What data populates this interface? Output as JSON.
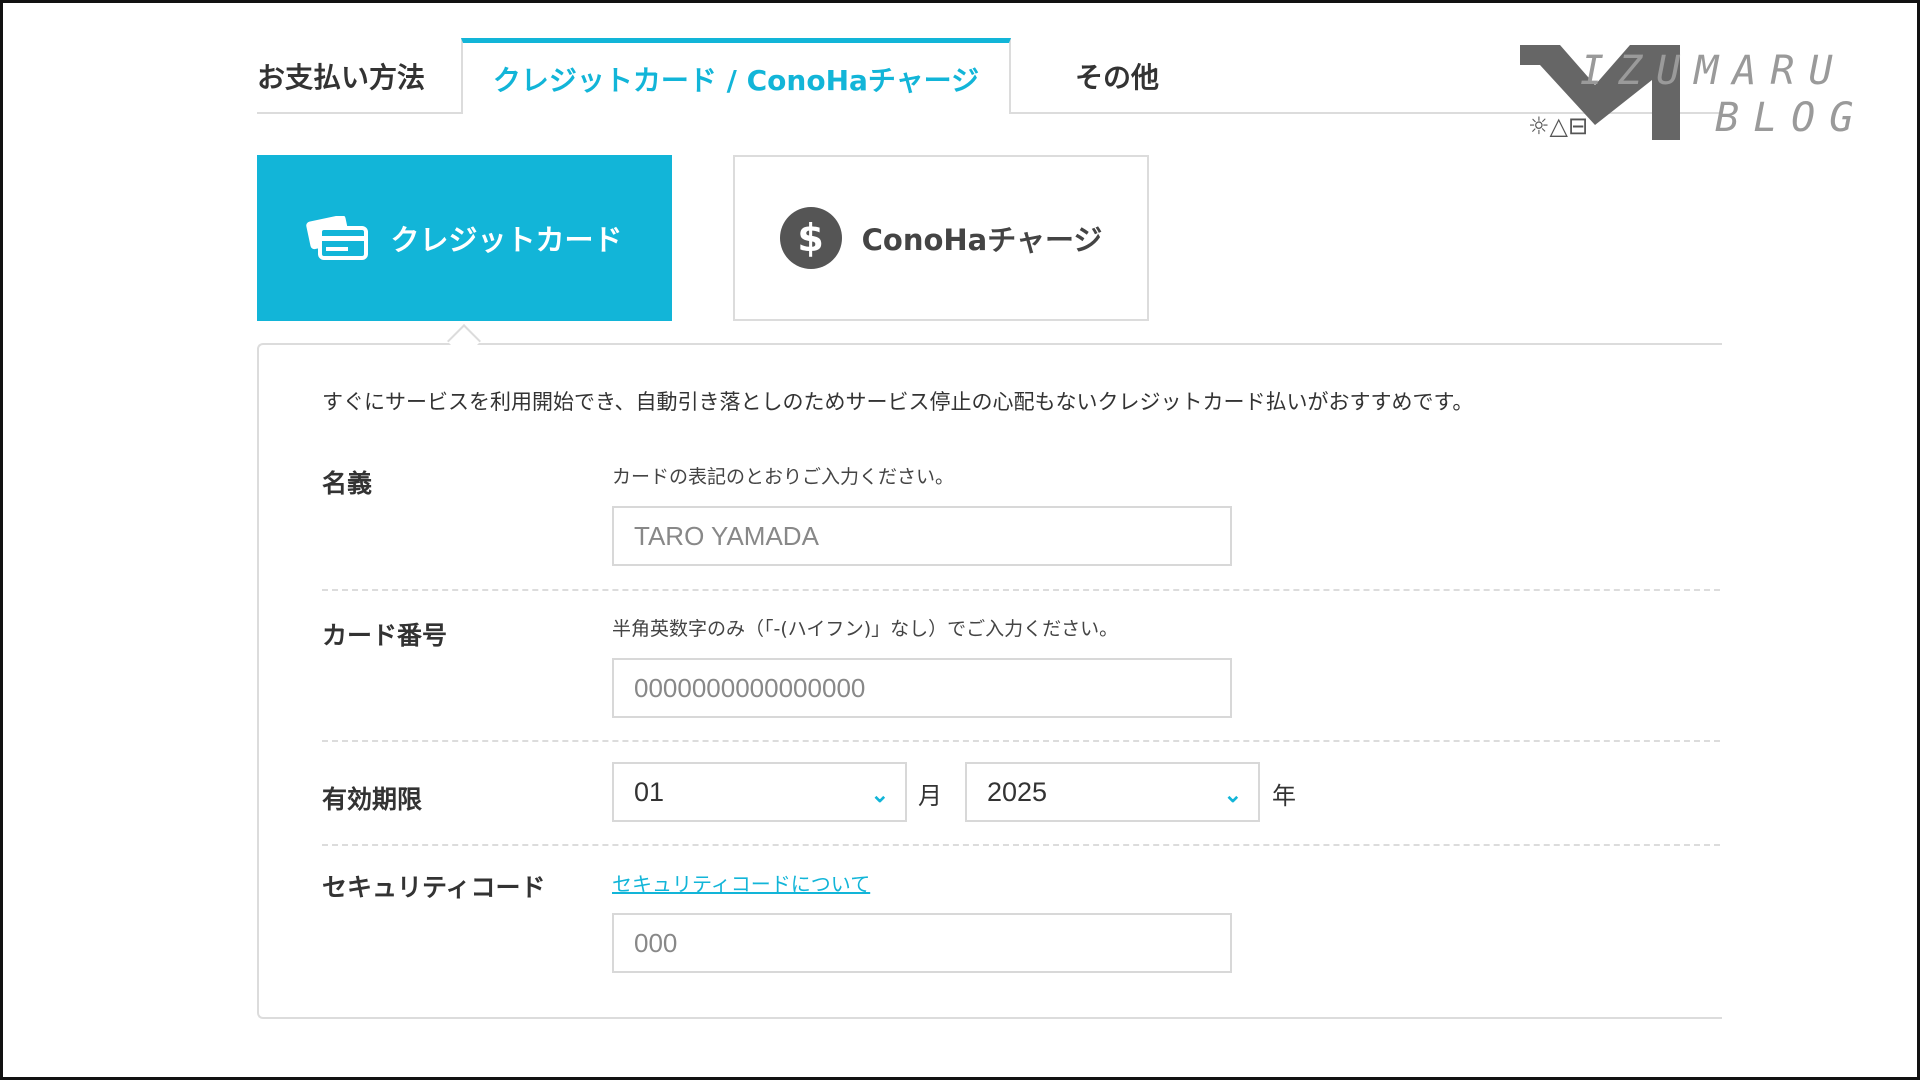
{
  "tabs": {
    "payment_method_label": "お支払い方法",
    "creditcard_conoha_label": "クレジットカード / ConoHaチャージ",
    "other_label": "その他"
  },
  "methods": {
    "creditcard_label": "クレジットカード",
    "conoha_charge_label": "ConoHaチャージ",
    "coin_symbol": "$"
  },
  "form": {
    "intro": "すぐにサービスを利用開始でき、自動引き落としのためサービス停止の心配もないクレジットカード払いがおすすめです。",
    "name": {
      "label": "名義",
      "hint": "カードの表記のとおりご入力ください。",
      "placeholder": "TARO YAMADA"
    },
    "card_number": {
      "label": "カード番号",
      "hint": "半角英数字のみ（「-(ハイフン)」なし）でご入力ください。",
      "placeholder": "0000000000000000"
    },
    "expiry": {
      "label": "有効期限",
      "month_value": "01",
      "month_unit": "月",
      "year_value": "2025",
      "year_unit": "年"
    },
    "security_code": {
      "label": "セキュリティコード",
      "link": "セキュリティコードについて",
      "placeholder": "000"
    }
  },
  "watermark": {
    "line1": "IZUMARU",
    "line2": "BLOG",
    "icons": "☼△⊟"
  },
  "colors": {
    "accent": "#12b5d8",
    "border": "#dcdcdc",
    "coin": "#555555"
  }
}
